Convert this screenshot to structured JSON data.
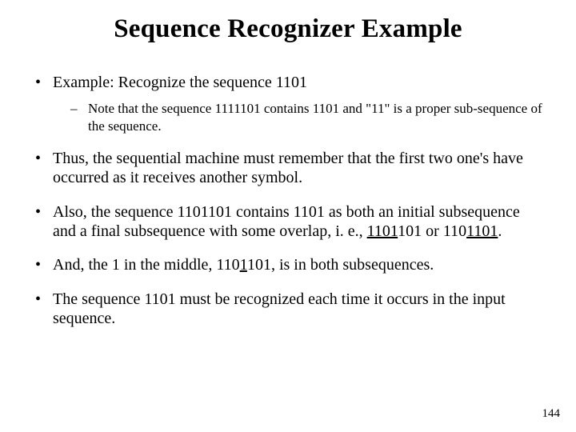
{
  "title": "Sequence Recognizer Example",
  "bullets": {
    "b1": {
      "text": "Example:  Recognize the sequence 1101",
      "sub": "Note that the sequence 1111101 contains 1101 and \"11\" is a proper sub-sequence of the sequence."
    },
    "b2": "Thus, the sequential machine must remember that the first two one's have occurred as it receives another symbol.",
    "b3": {
      "pre": "Also, the sequence 1101101 contains 1101 as both an initial subsequence and a final subsequence with some overlap, i. e., ",
      "u1": "1101",
      "mid1": "101 or 110",
      "u2": "1101",
      "post": "."
    },
    "b4": {
      "pre": "And, the 1 in the middle, 110",
      "u": "1",
      "post": "101, is in both subsequences."
    },
    "b5": "The sequence 1101 must be recognized each time it occurs in the input sequence."
  },
  "page_number": "144"
}
